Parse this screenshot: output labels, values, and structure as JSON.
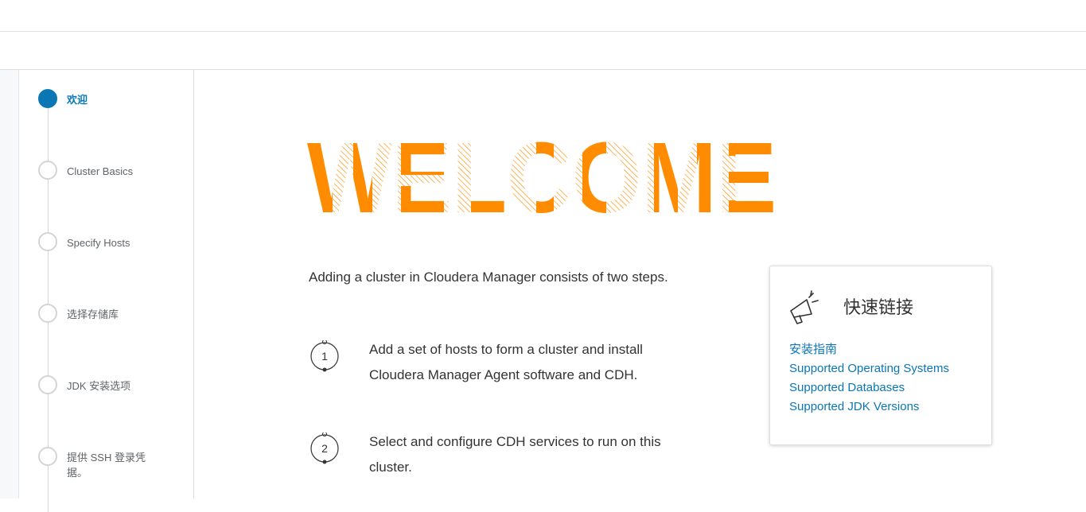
{
  "wizard": {
    "steps": [
      {
        "label": "欢迎",
        "active": true
      },
      {
        "label": "Cluster Basics",
        "active": false
      },
      {
        "label": "Specify Hosts",
        "active": false
      },
      {
        "label": "选择存储库",
        "active": false
      },
      {
        "label": "JDK 安装选项",
        "active": false
      },
      {
        "label": "提供 SSH 登录凭据。",
        "active": false
      }
    ]
  },
  "main": {
    "hero_text": "WELCOME",
    "intro": "Adding a cluster in Cloudera Manager consists of two steps.",
    "steps": [
      {
        "number": "1",
        "text": "Add a set of hosts to form a cluster and install Cloudera Manager Agent software and CDH."
      },
      {
        "number": "2",
        "text": "Select and configure CDH services to run on this cluster."
      }
    ]
  },
  "quick_links": {
    "icon": "megaphone-icon",
    "title": "快速链接",
    "links": [
      "安装指南",
      "Supported Operating Systems",
      "Supported Databases",
      "Supported JDK Versions"
    ]
  },
  "colors": {
    "accent": "#0a77b4",
    "hero_orange": "#ff8c00",
    "link": "#0a77b4"
  }
}
